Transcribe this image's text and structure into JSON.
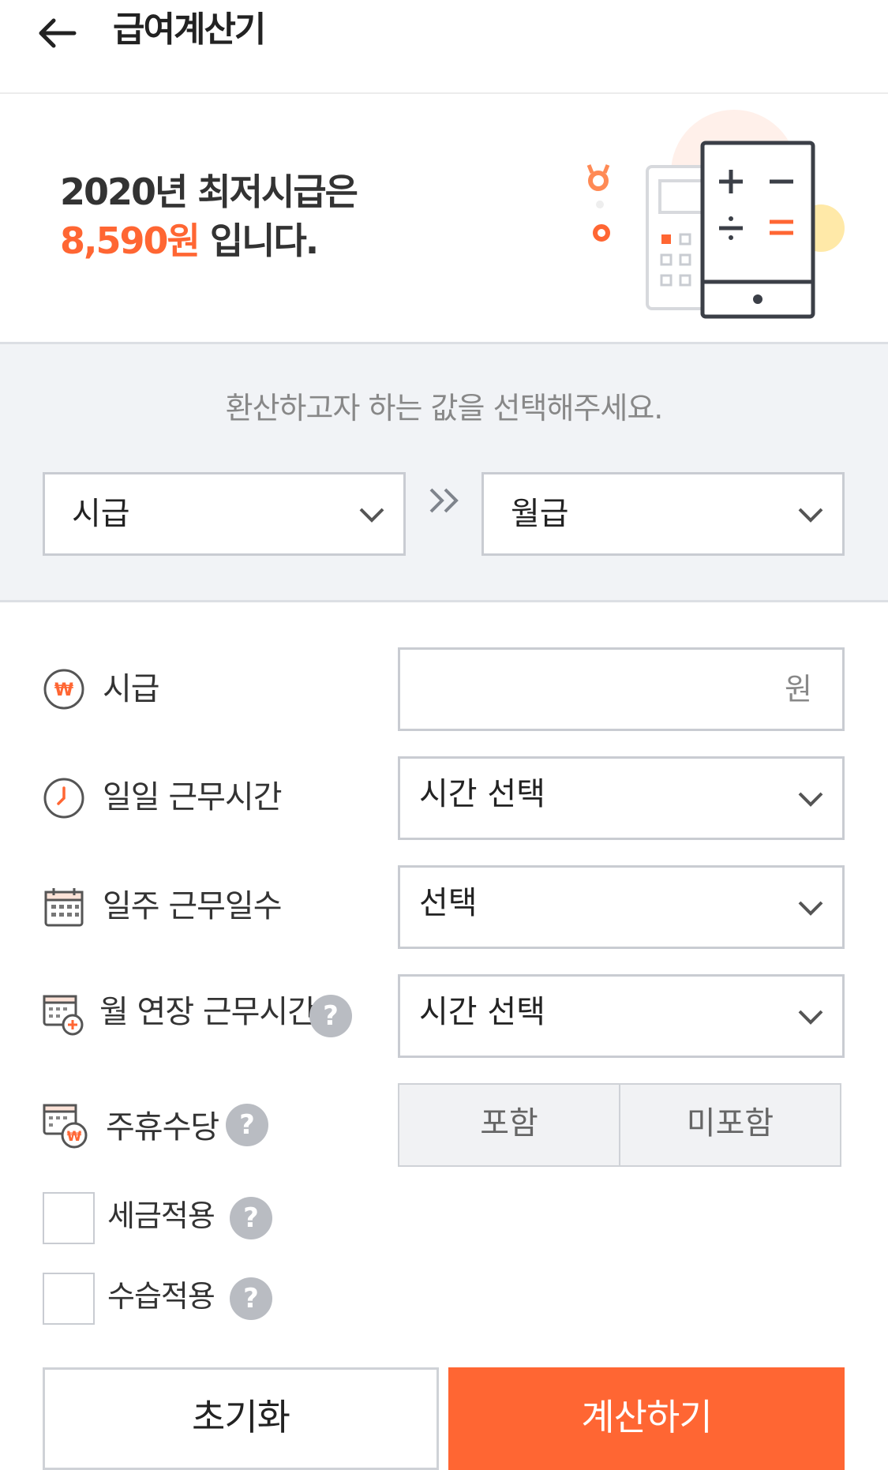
{
  "header": {
    "title": "급여계산기"
  },
  "banner": {
    "line1": "2020년 최저시급은",
    "wage": "8,590원",
    "suffix": " 입니다."
  },
  "selector": {
    "prompt": "환산하고자 하는 값을 선택해주세요.",
    "from": "시급",
    "to": "월급"
  },
  "fields": {
    "hourly": {
      "label": "시급",
      "unit": "원",
      "value": ""
    },
    "daily_hours": {
      "label": "일일 근무시간",
      "value": "시간 선택"
    },
    "weekly_days": {
      "label": "일주 근무일수",
      "value": "선택"
    },
    "overtime": {
      "label": "월 연장 근무시간",
      "value": "시간 선택"
    },
    "holiday_pay": {
      "label": "주휴수당",
      "options": [
        "포함",
        "미포함"
      ]
    },
    "tax": {
      "label": "세금적용"
    },
    "probation": {
      "label": "수습적용"
    }
  },
  "help_glyph": "?",
  "buttons": {
    "reset": "초기화",
    "calculate": "계산하기"
  },
  "colors": {
    "accent": "#ff6633",
    "panel": "#f1f3f6",
    "border": "#c9ccd2"
  }
}
